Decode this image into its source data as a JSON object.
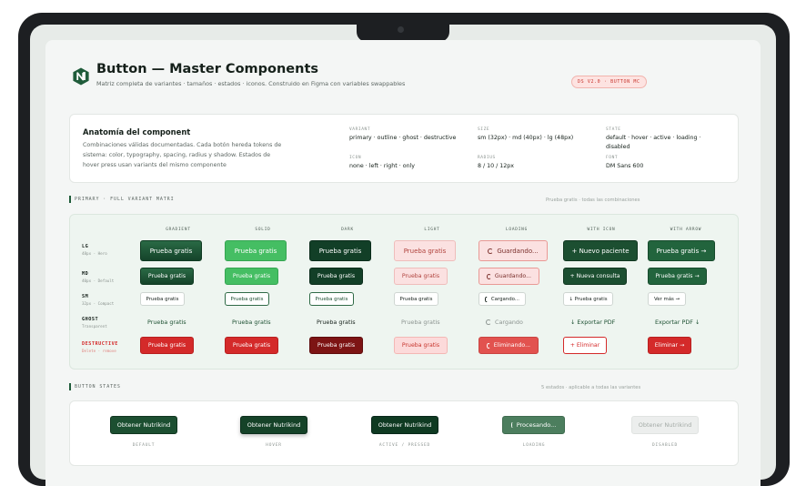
{
  "header": {
    "title": "Button — Master Components",
    "subtitle": "Matriz completa de variantes · tamaños · estados · iconos. Construido en Figma con variables swappables",
    "badge": "DS V2.0 · BUTTON MC"
  },
  "anatomy": {
    "title": "Anatomía del component",
    "description": "Combinaciones válidas documentadas. Cada botón hereda tokens de sistema: color, typography, spacing, radius y shadow. Estados de hover press usan variants del mismo componente",
    "props": [
      {
        "label": "VARIANT",
        "value": "primary · outline · ghost · destructive"
      },
      {
        "label": "SIZE",
        "value": "sm (32px) · md (40px) · lg (48px)"
      },
      {
        "label": "STATE",
        "value": "default · hover · active · loading · disabled"
      },
      {
        "label": "ICON",
        "value": "none · left · right · only"
      },
      {
        "label": "RADIUS",
        "value": "8 / 10 / 12px"
      },
      {
        "label": "FONT",
        "value": "DM Sans 600"
      }
    ]
  },
  "matrix": {
    "heading": "PRIMARY · FULL VARIANT MATRI",
    "right_note": "Prueba gratis · todas las combinaciones",
    "columns": [
      "GRADIENT",
      "SOLID",
      "DARK",
      "LIGHT",
      "LOADING",
      "WITH ICON",
      "WITH ARROW"
    ],
    "rows": [
      {
        "label": "LG",
        "sub": "48px · Hero",
        "buttons": [
          "Prueba gratis",
          "Prueba gratis",
          "Prueba gratis",
          "Prueba gratis",
          "Guardando...",
          "+ Nuevo paciente",
          "Prueba gratis →"
        ]
      },
      {
        "label": "MD",
        "sub": "40px · Default",
        "buttons": [
          "Prueba gratis",
          "Prueba gratis",
          "Prueba gratis",
          "Prueba gratis",
          "Guardando...",
          "+ Nueva consulta",
          "Prueba gratis →"
        ]
      },
      {
        "label": "SM",
        "sub": "32px · Compact",
        "buttons": [
          "Prueba gratis",
          "Prueba gratis",
          "Prueba gratis",
          "Prueba gratis",
          "Cargando...",
          "↓ Prueba gratis",
          "Ver más →"
        ]
      },
      {
        "label": "GHOST",
        "sub": "Transparent",
        "buttons": [
          "Prueba gratis",
          "Prueba gratis",
          "Prueba gratis",
          "Prueba gratis",
          "Cargando",
          "↓ Exportar PDF",
          "Exportar PDF ↓"
        ]
      },
      {
        "label": "DESTRUCTIVE",
        "sub": "Delete · remove",
        "buttons": [
          "Prueba gratis",
          "Prueba gratis",
          "Prueba gratis",
          "Prueba gratis",
          "Eliminando...",
          "+ Eliminar",
          "Eliminar →"
        ]
      }
    ]
  },
  "states": {
    "heading": "BUTTON STATES",
    "right_note": "5 estados · aplicable a todas las variantes",
    "items": [
      {
        "label": "Obtener Nutrikind",
        "caption": "DEFAULT"
      },
      {
        "label": "Obtener Nutrikind",
        "caption": "HOVER"
      },
      {
        "label": "Obtener Nutrikind",
        "caption": "ACTIVE / PRESSED"
      },
      {
        "label": "Procesando...",
        "caption": "LOADING"
      },
      {
        "label": "Obtener Nutrikind",
        "caption": "DISABLED"
      }
    ]
  },
  "colors": {
    "brand": "#1c4f31",
    "accent_green": "#45be63",
    "destructive": "#d42a2a"
  }
}
